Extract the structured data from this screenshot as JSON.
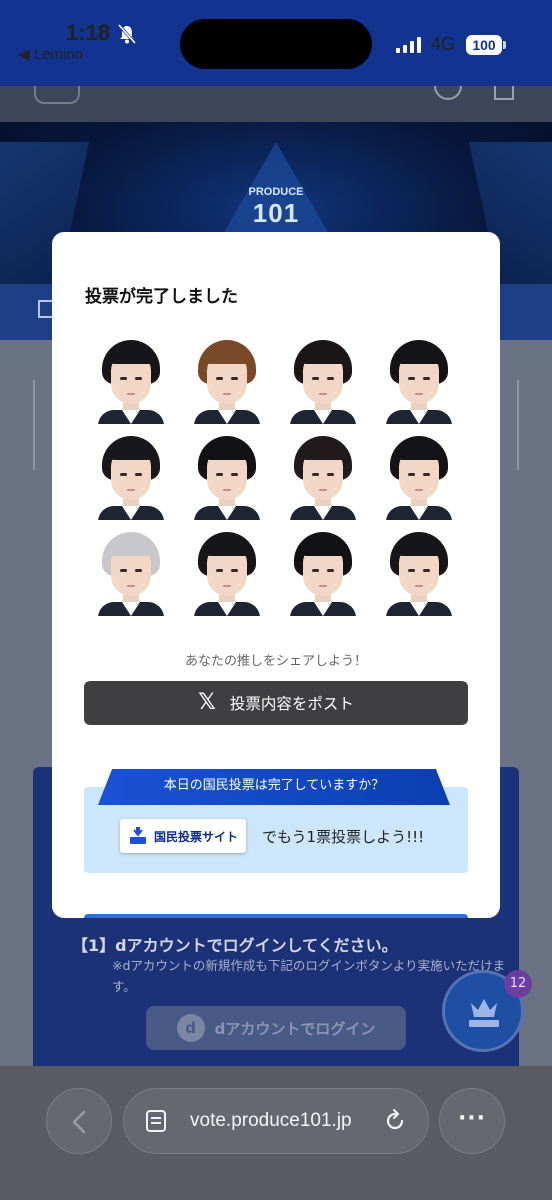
{
  "status_bar": {
    "time": "1:18",
    "back_app": "◀ Lemino",
    "network": "4G",
    "battery": "100"
  },
  "hero": {
    "logo_text": "PRODUCE",
    "logo_number": "101"
  },
  "background_page": {
    "step_title": "【1】dアカウントでログインしてください。",
    "step_note": "※dアカウントの新規作成も下記のログインボタンより実施いただけます。",
    "login_button": "dアカウントでログイン",
    "login_d": "d",
    "fab_badge": "12"
  },
  "modal": {
    "title": "投票が完了しました",
    "share_prompt": "あなたの推しをシェアしよう！",
    "post_button": "投票内容をポスト",
    "x_glyph": "𝕏",
    "banner_ribbon": "本日の国民投票は完了していますか？",
    "site_chip": "国民投票サイト",
    "vote_cta": "でもう1票投票しよう!!!"
  },
  "browser": {
    "url": "vote.produce101.jp",
    "more": "···"
  },
  "colors": {
    "status_blue": "#12338f",
    "post_button": "#3f3f41",
    "banner_bg": "#cce6fb",
    "ribbon_blue": "#1a52d6"
  },
  "icons": [
    "bell-slash-icon",
    "signal-icon",
    "x-logo-icon",
    "ballot-icon",
    "crown-icon",
    "tabs-icon",
    "reload-icon",
    "chevron-left-icon",
    "more-icon"
  ]
}
